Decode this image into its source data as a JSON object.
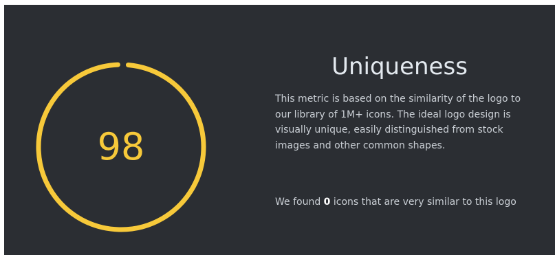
{
  "uniqueness": {
    "score": "98",
    "score_fraction": 0.98,
    "accent_color": "#f7c93a",
    "title": "Uniqueness",
    "description": "This metric is based on the similarity of the logo to our library of 1M+ icons. The ideal logo design is visually unique, easily distinguished from stock images and other common shapes.",
    "found_prefix": "We found ",
    "found_count": "0",
    "found_suffix": " icons that are very similar to this logo"
  }
}
